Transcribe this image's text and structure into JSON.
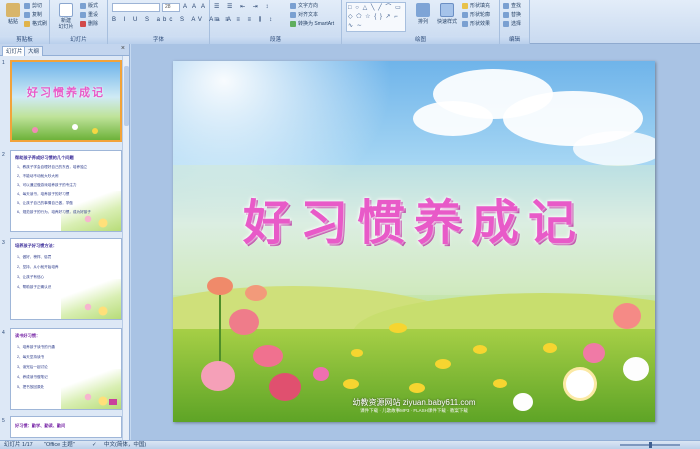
{
  "ribbon": {
    "clipboard": {
      "label": "剪贴板",
      "paste": "粘贴",
      "cut": "剪切",
      "copy": "复制",
      "format_painter": "格式刷"
    },
    "slides": {
      "label": "幻灯片",
      "new_slide": "新建\n幻灯片",
      "layout": "版式",
      "reset": "重设",
      "delete": "删除"
    },
    "font": {
      "label": "字体",
      "font_name": "",
      "font_size": "28",
      "format_row": "B I U S abc S AV Aa A",
      "grow_row": "A A A"
    },
    "paragraph": {
      "label": "段落",
      "align_row": "≡ ≡ ≡ ≡ ⫼ ↕",
      "text_direction": "文字方向",
      "align_text": "对齐文本",
      "smartart": "转换为 SmartArt"
    },
    "drawing": {
      "label": "绘图",
      "shapes_preview": "□ ○ △ ╲ ╱ ⌒ ▭ ◇ ⬠ ☆ { } ↗ ⌐ ∿ ∼",
      "arrange": "排列",
      "quick_styles": "快速样式",
      "shape_fill": "形状填充",
      "shape_outline": "形状轮廓",
      "shape_effects": "形状效果"
    },
    "editing": {
      "label": "编辑",
      "find": "查找",
      "replace": "替换",
      "select": "选择"
    }
  },
  "panel": {
    "tab_slides": "幻灯片",
    "tab_outline": "大纲",
    "close": "×",
    "thumbs": [
      {
        "num": "1",
        "title": "好习惯养成记"
      },
      {
        "num": "2",
        "title": "帮助孩子养成好习惯的几个问题",
        "lines": [
          "1、教孩子学会自理好自己的东西，培养独立",
          "2、不能动不动就大吵大闹",
          "3、可以通过做游戏培养孩子的专注力",
          "4、每天读书，培养孩子的好习惯",
          "5、让孩子自己的事情自己做，学做",
          "6、规范孩子的行为，培养好习惯，成为好孩子"
        ]
      },
      {
        "num": "3",
        "title": "培养孩子好习惯方法：",
        "lines": [
          "1、做好、榜样、惩罚",
          "2、坚持，从小就开始培养",
          "3、让孩子有信心",
          "4、帮助孩子正确认识"
        ]
      },
      {
        "num": "4",
        "title": "读书好习惯：",
        "lines": [
          "1、培养孩子读书的兴趣",
          "2、每天坚持读书",
          "3、读完后一起讨论",
          "4、养成读书做笔记",
          "5、把书放回原处"
        ]
      },
      {
        "num": "5",
        "title": "好习惯：勤学、勤读、勤问"
      }
    ]
  },
  "slide": {
    "title": "好习惯养成记",
    "footer_main": "幼教资源网站  ziyuan.baby611.com",
    "footer_sub": "课件下载 · 儿歌故事MP3 · FLASH课件下载 · 教案下载"
  },
  "status": {
    "slide_count": "幻灯片 1/17",
    "theme": "\"Office 主题\"",
    "language": "中文(简体，中国)"
  },
  "colors": {
    "title_pink": "#e85ac8",
    "ribbon_blue": "#c9daf0",
    "selection_orange": "#f2a33a"
  }
}
